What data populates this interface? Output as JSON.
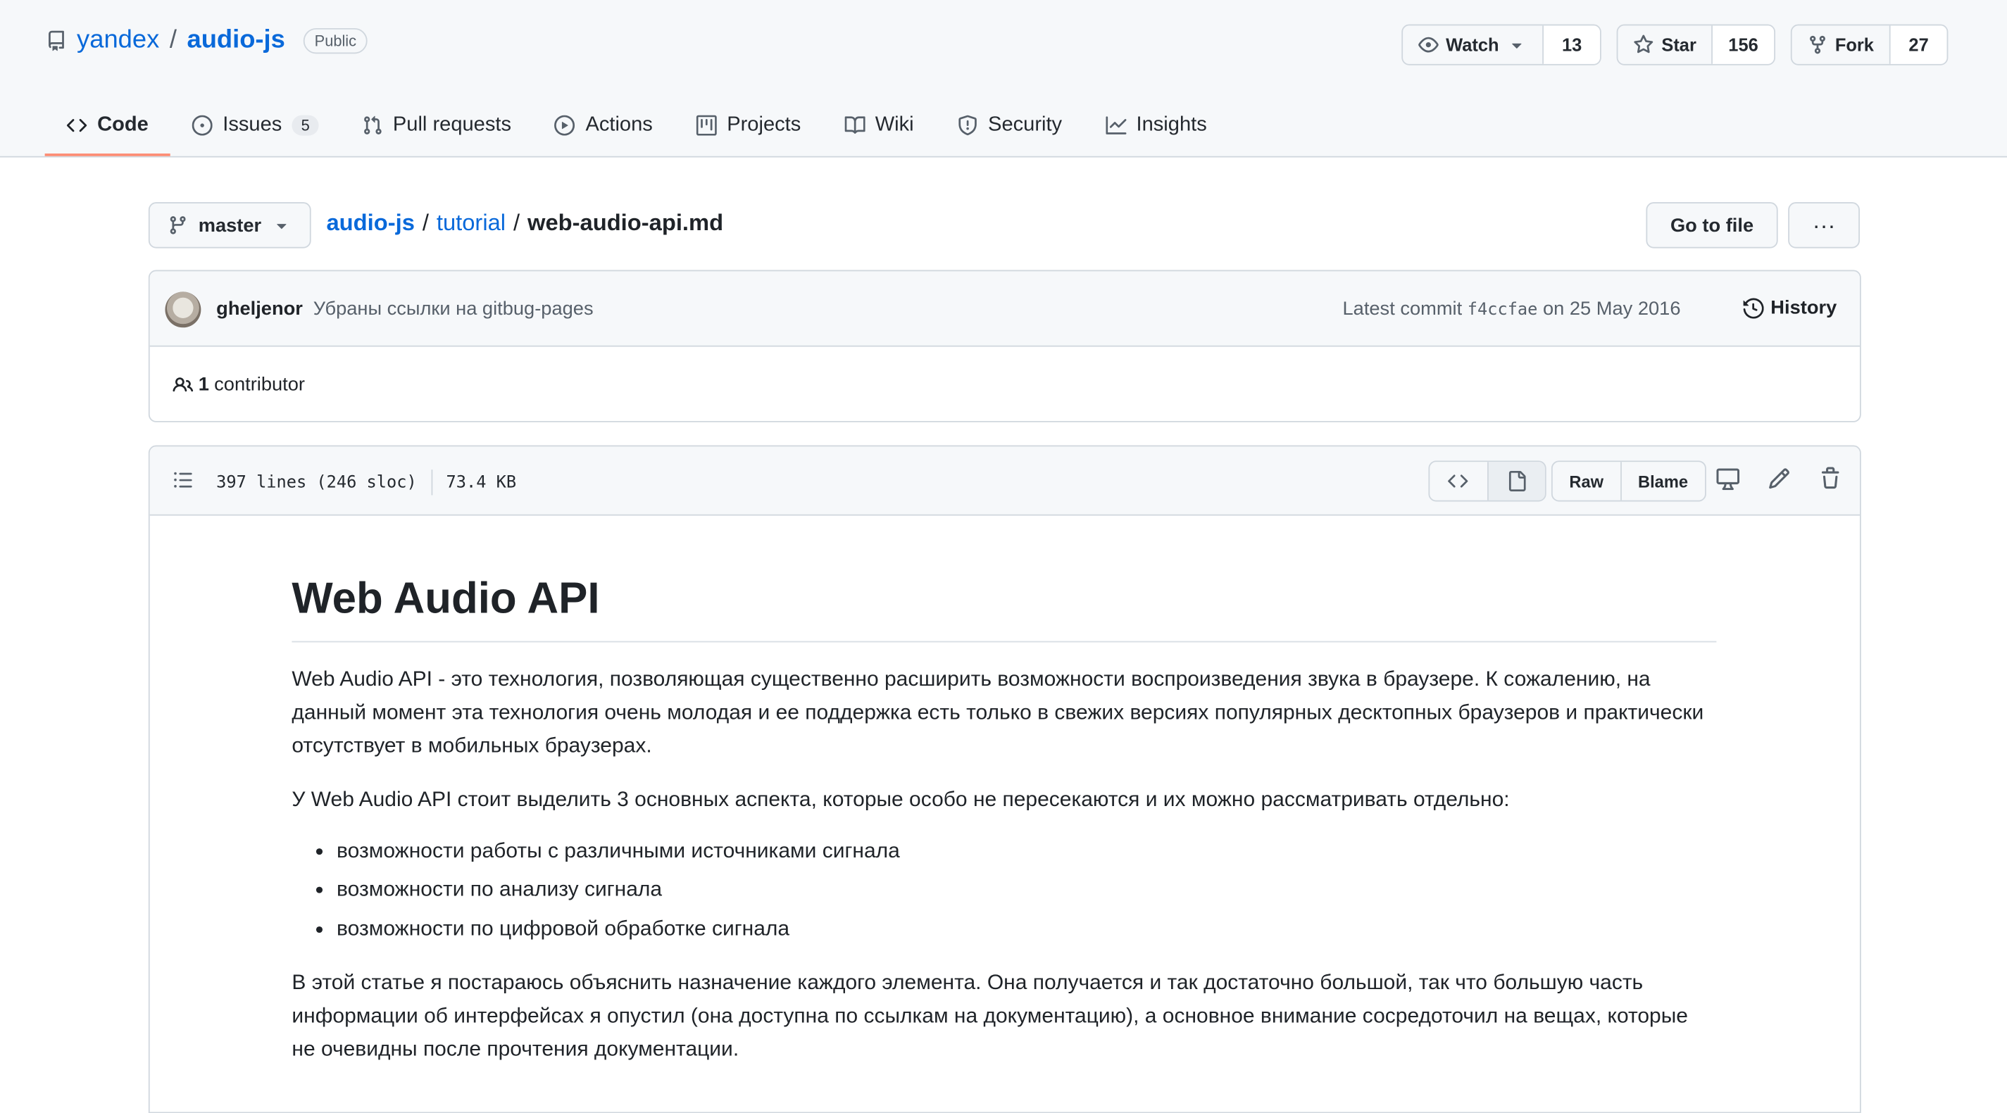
{
  "repo": {
    "owner": "yandex",
    "separator": "/",
    "name": "audio-js",
    "visibility": "Public",
    "watch": {
      "label": "Watch",
      "count": "13"
    },
    "star": {
      "label": "Star",
      "count": "156"
    },
    "fork": {
      "label": "Fork",
      "count": "27"
    }
  },
  "tabs": [
    {
      "label": "Code",
      "icon": "code-icon"
    },
    {
      "label": "Issues",
      "icon": "issue-icon",
      "counter": "5"
    },
    {
      "label": "Pull requests",
      "icon": "pull-request-icon"
    },
    {
      "label": "Actions",
      "icon": "play-icon"
    },
    {
      "label": "Projects",
      "icon": "table-icon"
    },
    {
      "label": "Wiki",
      "icon": "book-icon"
    },
    {
      "label": "Security",
      "icon": "shield-icon"
    },
    {
      "label": "Insights",
      "icon": "graph-icon"
    }
  ],
  "breadcrumb": {
    "branch": "master",
    "repo": "audio-js",
    "folder": "tutorial",
    "file": "web-audio-api.md",
    "sep": "/",
    "go_to_file": "Go to file",
    "more": "···"
  },
  "commit": {
    "author": "gheljenor",
    "message": "Убраны ссылки на gitbug-pages",
    "latest_label": "Latest commit",
    "sha": "f4ccfae",
    "date": "on 25 May 2016",
    "history": "History",
    "contributors_count": "1",
    "contributors_label": "contributor"
  },
  "file": {
    "lines": "397 lines (246 sloc)",
    "size": "73.4 KB",
    "raw": "Raw",
    "blame": "Blame"
  },
  "content": {
    "title": "Web Audio API",
    "p1": "Web Audio API - это технология, позволяющая существенно расширить возможности воспроизведения звука в браузере. К сожалению, на данный момент эта технология очень молодая и ее поддержка есть только в свежих версиях популярных десктопных браузеров и практически отсутствует в мобильных браузерах.",
    "p2": "У Web Audio API стоит выделить 3 основных аспекта, которые особо не пересекаются и их можно рассматривать отдельно:",
    "list": [
      "возможности работы с различными источниками сигнала",
      "возможности по анализу сигнала",
      "возможности по цифровой обработке сигнала"
    ],
    "p3": "В этой статье я постараюсь объяснить назначение каждого элемента. Она получается и так достаточно большой, так что большую часть информации об интерфейсах я опустил (она доступна по ссылкам на документацию), а основное внимание сосредоточил на вещах, которые не очевидны после прочтения документации."
  },
  "colors": {
    "link": "#0969da",
    "active_tab_underline": "#fd8c73",
    "header_bg": "#f6f8fa",
    "border": "#d0d7de"
  }
}
